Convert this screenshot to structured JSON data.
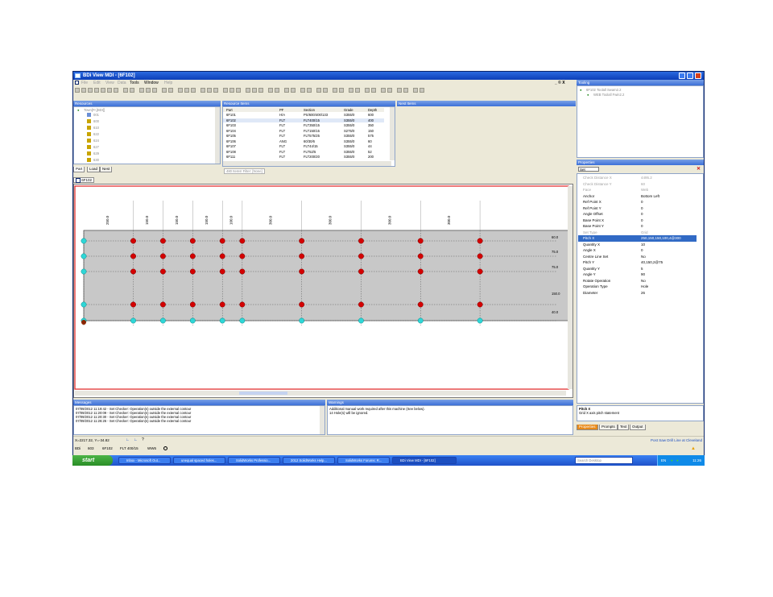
{
  "window": {
    "title": "BDi View MDI - [6F102]"
  },
  "menu": {
    "items": [
      "File",
      "Edit",
      "View",
      "Data",
      "Tools",
      "Window",
      "Help"
    ],
    "doc_controls": "_ © X"
  },
  "resources": {
    "header": "Resources",
    "tree_root": "Town[Fr,[BDI]]",
    "tree_items": [
      "001",
      "600",
      "610",
      "622",
      "624",
      "627",
      "629",
      "630"
    ],
    "tabs": [
      "Part",
      "Load",
      "Nest"
    ]
  },
  "resource_items": {
    "header": "Resource Items",
    "columns": [
      "Part",
      "PF",
      "Section",
      "Grade",
      "Depth"
    ],
    "rows": [
      [
        "6F101",
        "H/A",
        "PS/600/400/133",
        "S355/0",
        "600"
      ],
      [
        "6F102",
        "FLT",
        "FLT400/15",
        "S355/0",
        "400"
      ],
      [
        "6F103",
        "FLT",
        "FLT350/15",
        "S355/0",
        "350"
      ],
      [
        "6F104",
        "FLT",
        "FLT150/15",
        "S275/0",
        "150"
      ],
      [
        "6F105",
        "FLT",
        "FLT575/25",
        "S355/0",
        "575"
      ],
      [
        "6F106",
        "ANG",
        "60/30/6",
        "S355/0",
        "60"
      ],
      [
        "6F107",
        "FLT",
        "FLT44/15",
        "S355/0",
        "44"
      ],
      [
        "6F108",
        "FLT",
        "FLT52/5",
        "S355/0",
        "52"
      ],
      [
        "6F111",
        "FLT",
        "FLT200/20",
        "S355/0",
        "200"
      ]
    ],
    "filter_label": "480 Items! Filter: [None]"
  },
  "nest_items": {
    "header": "Nest Items"
  },
  "tooling": {
    "header": "Tooling",
    "items": [
      "6F102 Toolall Swam2.2",
      "WEB Toolall Fwin2.2"
    ]
  },
  "properties": {
    "header": "Properties",
    "set_label": "Set",
    "rows": [
      {
        "k": "Check Distance X",
        "v": "4495.2",
        "grey": true
      },
      {
        "k": "Check Distance Y",
        "v": "60",
        "grey": true
      },
      {
        "k": "Face",
        "v": "Web",
        "grey": true
      },
      {
        "k": "Anchor",
        "v": "Bottom Left",
        "grey": false
      },
      {
        "k": "Ref Point X",
        "v": "0",
        "grey": false
      },
      {
        "k": "Ref Point Y",
        "v": "0",
        "grey": false
      },
      {
        "k": "Angle Offset",
        "v": "0",
        "grey": false
      },
      {
        "k": "Base Point X",
        "v": "0",
        "grey": false
      },
      {
        "k": "Base Point Y",
        "v": "0",
        "grey": false
      },
      {
        "k": "Set Type",
        "v": "Grid",
        "grey": true
      },
      {
        "k": "Pitch X",
        "v": "250,150,150,100,4@300",
        "grey": false,
        "sel": true
      },
      {
        "k": "Quantity X",
        "v": "10",
        "grey": false
      },
      {
        "k": "Angle X",
        "v": "0",
        "grey": false
      },
      {
        "k": "Centre Line Set",
        "v": "No",
        "grey": false
      },
      {
        "k": "Pitch Y",
        "v": "40,150,2@75",
        "grey": false
      },
      {
        "k": "Quantity Y",
        "v": "5",
        "grey": false
      },
      {
        "k": "Angle Y",
        "v": "90",
        "grey": false
      },
      {
        "k": "Rotate Operation",
        "v": "No",
        "grey": false
      },
      {
        "k": "Operation Type",
        "v": "Hole",
        "grey": false
      },
      {
        "k": "Diameter",
        "v": "26",
        "grey": false
      }
    ],
    "help_title": "Pitch X",
    "help_text": "Grid X axis pitch statement",
    "tabs": [
      "Properties",
      "Prompts",
      "Text",
      "Output"
    ]
  },
  "document": {
    "tab": "6F102",
    "x_dims": [
      "250.0",
      "150.0",
      "150.0",
      "150.0",
      "100.0",
      "300.0",
      "300.0",
      "300.0",
      "300.0"
    ],
    "y_dims": [
      "60.0",
      "75.0",
      "75.0",
      "150.0",
      "40.0"
    ]
  },
  "messages": {
    "header": "Messages",
    "lines": [
      "07/09/2012 11:19:42 - Set Checker: Operation(s) outside the external contour",
      "07/09/2012 11:20:09 - Set Checker: Operation(s) outside the external contour",
      "07/09/2012 11:20:30 - Set Checker: Operation(s) outside the external contour",
      "07/09/2012 11:26:26 - Set Checker: Operation(s) outside the external contour"
    ]
  },
  "warnings": {
    "header": "Warnings",
    "lines": [
      "Additional manual work required after this machine (See below).",
      "14 Hole(s) will be ignored."
    ]
  },
  "status": {
    "coords": "X=2217.32, Y=-34.82",
    "bottom_items": [
      "BDi",
      "603",
      "6F102",
      "FLT 400/15",
      "WW6"
    ],
    "right": "Post Saw Drill Line at Cleveland"
  },
  "taskbar": {
    "start": "start",
    "tasks": [
      "Inbox - Microsoft Out...",
      "unequal spaced holes...",
      "SolidWorks Professio...",
      "2012 SolidWorks Help...",
      "SolidWorks Forums: R...",
      "BDi View MDI - [6F102]"
    ],
    "search": "Search Desktop",
    "lang": "EN",
    "clock": "11:26"
  },
  "colors": {
    "title_blue": "#0d3fb8",
    "hole_red": "#d40000",
    "hole_cyan": "#2fd7d7",
    "plate_grey": "#c8c8c8",
    "canvas_border_red": "#e02020"
  }
}
